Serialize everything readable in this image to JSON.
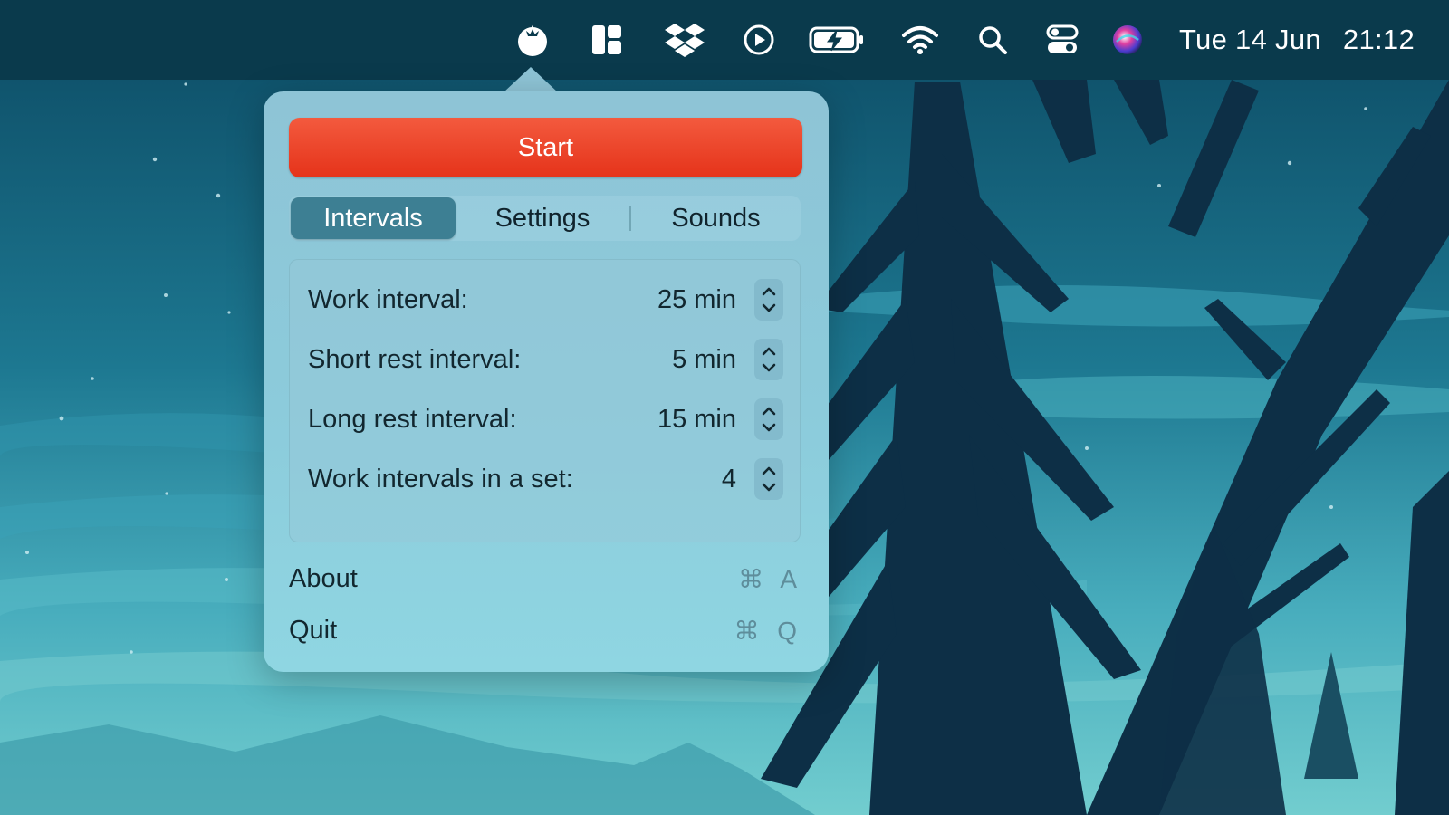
{
  "menubar": {
    "icons": [
      "tomato-icon",
      "layout-icon",
      "dropbox-icon",
      "play-icon",
      "battery-charging-icon",
      "wifi-icon",
      "search-icon",
      "control-center-icon",
      "siri-icon"
    ],
    "date": "Tue 14 Jun",
    "time": "21:12"
  },
  "popover": {
    "start_label": "Start",
    "tabs": [
      {
        "label": "Intervals",
        "active": true
      },
      {
        "label": "Settings",
        "active": false
      },
      {
        "label": "Sounds",
        "active": false
      }
    ],
    "intervals": [
      {
        "label": "Work interval:",
        "value": "25 min"
      },
      {
        "label": "Short rest interval:",
        "value": "5 min"
      },
      {
        "label": "Long rest interval:",
        "value": "15 min"
      },
      {
        "label": "Work intervals in a set:",
        "value": "4"
      }
    ],
    "menu": [
      {
        "label": "About",
        "shortcut": "⌘ A"
      },
      {
        "label": "Quit",
        "shortcut": "⌘ Q"
      }
    ]
  },
  "colors": {
    "start_button": "#e83d22",
    "active_tab": "#3d7f93",
    "menubar": "#0a3a4c"
  }
}
